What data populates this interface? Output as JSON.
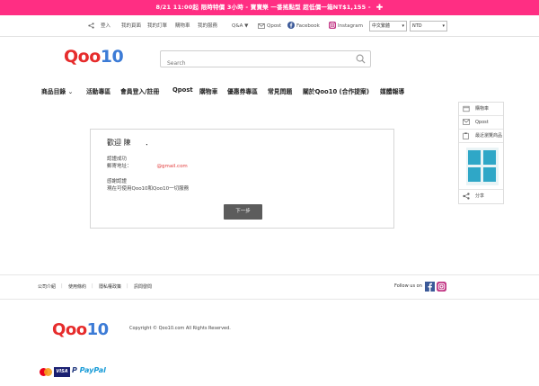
{
  "promo": {
    "text": "8/21 11:00起 限時特價 3小時 - 寶寶樂 一番搖點型 超低價一箱NT$1,155 -",
    "bg": "#ff2e83"
  },
  "topbar": {
    "login": "登入",
    "my_page": "我的頁面",
    "my_orders": "我的訂單",
    "cart": "購物車",
    "service": "我的服務",
    "qa": "Q&A ▼",
    "qpost": "Qpost",
    "facebook": "Facebook",
    "instagram": "Instagram",
    "language": "中文繁體",
    "currency": "NTD"
  },
  "logo": {
    "text": "Qoo10"
  },
  "search": {
    "placeholder": "Search"
  },
  "nav": {
    "items": [
      "商品目錄",
      "活動專區",
      "會員登入/註冊",
      "Qpost",
      "購物車",
      "優惠券專區",
      "常見問題",
      "關於Qoo10 (合作提案)",
      "媒體報導"
    ]
  },
  "sidebar": {
    "cart": "購物車",
    "qpost": "Qpost",
    "recent": "最近瀏覽商品",
    "share": "分享"
  },
  "card": {
    "title": "歡迎 陳　　．",
    "line1": "認證成功",
    "line2": "郵寄地址：",
    "email": "@gmail.com",
    "line3": "感謝認證",
    "line4": "現在可使用Qoo10和Qoo10一切服務",
    "next": "下一步"
  },
  "footer": {
    "links": [
      "公司介紹",
      "使用條約",
      "隱私權政策",
      "訊問發問"
    ],
    "follow": "Follow us on",
    "copyright": "Copyright © Qoo10.com All Rights Reserved.",
    "paypal": "PayPal",
    "visa": "VISA"
  }
}
